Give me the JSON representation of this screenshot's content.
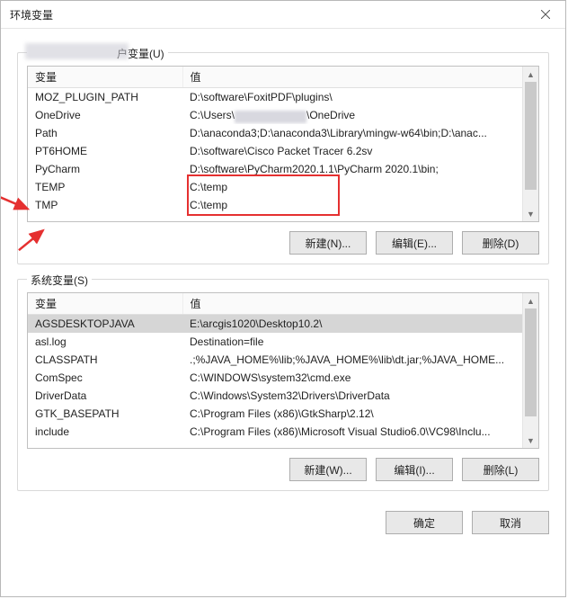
{
  "window": {
    "title": "环境变量"
  },
  "user_group": {
    "legend": "　　　　　　　　户变量(U)",
    "col_var": "变量",
    "col_val": "值",
    "rows": [
      {
        "name": "MOZ_PLUGIN_PATH",
        "value": "D:\\software\\FoxitPDF\\plugins\\"
      },
      {
        "name": "OneDrive",
        "value_pre": "C:\\Users\\",
        "value_post": "\\OneDrive",
        "masked": true
      },
      {
        "name": "Path",
        "value": "D:\\anaconda3;D:\\anaconda3\\Library\\mingw-w64\\bin;D:\\anac..."
      },
      {
        "name": "PT6HOME",
        "value": "D:\\software\\Cisco Packet Tracer 6.2sv"
      },
      {
        "name": "PyCharm",
        "value": "D:\\software\\PyCharm2020.1.1\\PyCharm 2020.1\\bin;"
      },
      {
        "name": "TEMP",
        "value": "C:\\temp"
      },
      {
        "name": "TMP",
        "value": "C:\\temp"
      }
    ],
    "buttons": {
      "new": "新建(N)...",
      "edit": "编辑(E)...",
      "del": "删除(D)"
    }
  },
  "sys_group": {
    "legend": "系统变量(S)",
    "col_var": "变量",
    "col_val": "值",
    "rows": [
      {
        "name": "AGSDESKTOPJAVA",
        "value": "E:\\arcgis1020\\Desktop10.2\\",
        "selected": true
      },
      {
        "name": "asl.log",
        "value": "Destination=file"
      },
      {
        "name": "CLASSPATH",
        "value": ".;%JAVA_HOME%\\lib;%JAVA_HOME%\\lib\\dt.jar;%JAVA_HOME..."
      },
      {
        "name": "ComSpec",
        "value": "C:\\WINDOWS\\system32\\cmd.exe"
      },
      {
        "name": "DriverData",
        "value": "C:\\Windows\\System32\\Drivers\\DriverData"
      },
      {
        "name": "GTK_BASEPATH",
        "value": "C:\\Program Files (x86)\\GtkSharp\\2.12\\"
      },
      {
        "name": "include",
        "value": "C:\\Program Files (x86)\\Microsoft Visual Studio6.0\\VC98\\Inclu..."
      }
    ],
    "buttons": {
      "new": "新建(W)...",
      "edit": "编辑(I)...",
      "del": "删除(L)"
    }
  },
  "footer": {
    "ok": "确定",
    "cancel": "取消"
  }
}
